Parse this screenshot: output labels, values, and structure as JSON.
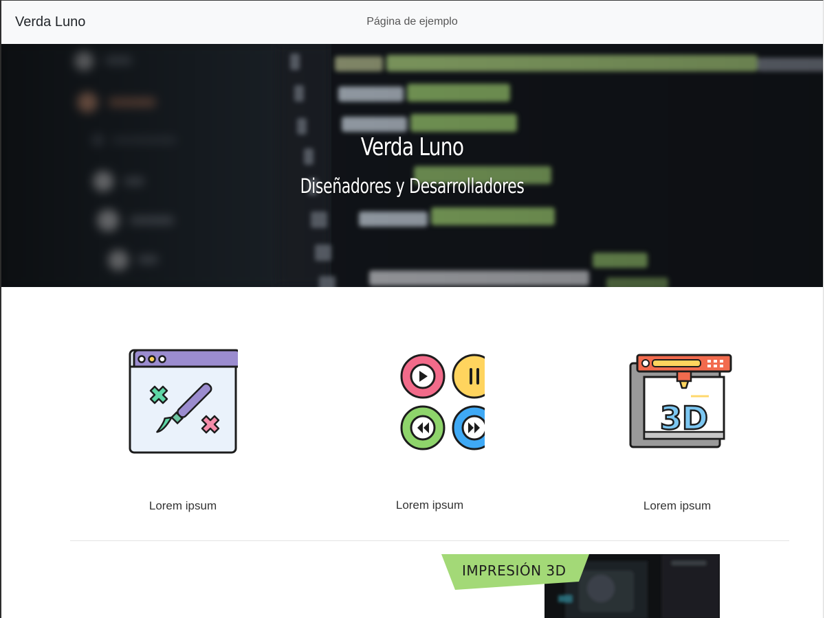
{
  "navbar": {
    "brand": "Verda Luno",
    "center_link": "Página de ejemplo"
  },
  "hero": {
    "title": "Verda Luno",
    "subtitle": "Diseñadores y Desarrolladores"
  },
  "features": [
    {
      "label": "Lorem ipsum",
      "icon": "web-design-icon"
    },
    {
      "label": "Lorem ipsum",
      "icon": "media-controls-icon"
    },
    {
      "label": "Lorem ipsum",
      "icon": "3d-printer-icon"
    }
  ],
  "promo": {
    "tag": "IMPRESIÓN 3D",
    "tag_color": "#a3d977"
  },
  "colors": {
    "navbar_bg": "#f8f9fa",
    "hero_bg": "#1c2027",
    "accent_green": "#a3d977"
  }
}
